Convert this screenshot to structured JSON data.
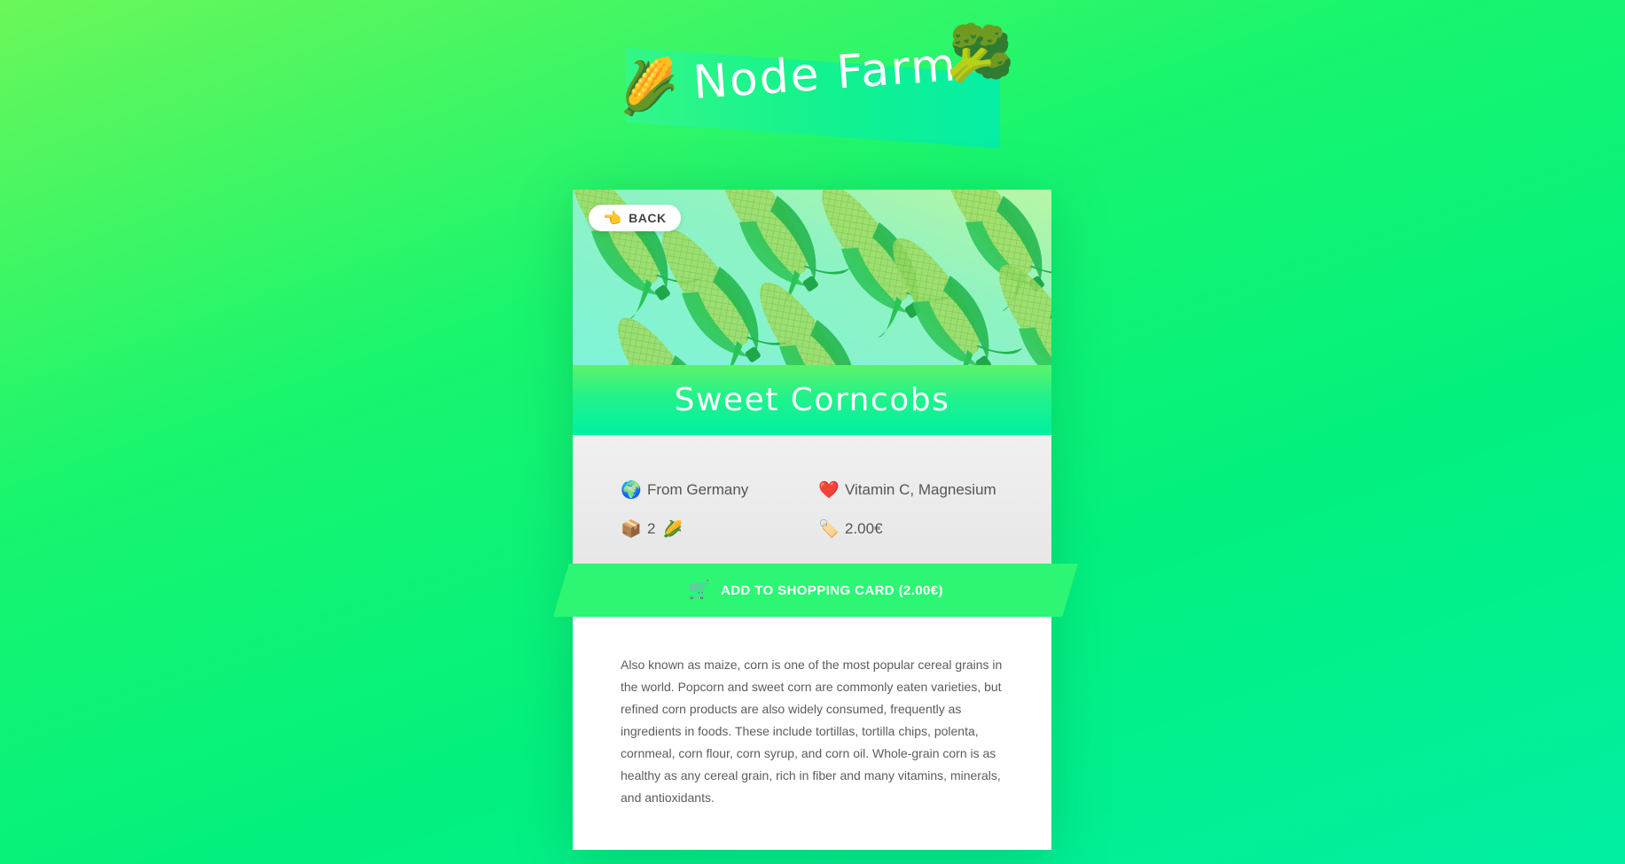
{
  "header": {
    "title": "Node Farm",
    "corn_icon": "🌽",
    "broccoli_icon": "🥦"
  },
  "product": {
    "back_icon": "👈",
    "back_label": "BACK",
    "name": "Sweet Corncobs",
    "origin_icon": "🌍",
    "origin": "From Germany",
    "nutrients_icon": "❤️",
    "nutrients": "Vitamin C, Magnesium",
    "quantity_icon": "📦",
    "quantity": "2",
    "quantity_emoji": "🌽",
    "price_icon": "🏷️",
    "price": "2.00€",
    "cart_icon": "🛒",
    "cart_label": "ADD TO SHOPPING CARD (2.00€)",
    "description": "Also known as maize, corn is one of the most popular cereal grains in the world. Popcorn and sweet corn are commonly eaten varieties, but refined corn products are also widely consumed, frequently as ingredients in foods. These include tortillas, tortilla chips, polenta, cornmeal, corn flour, corn syrup, and corn oil. Whole-grain corn is as healthy as any cereal grain, rich in fiber and many vitamins, minerals, and antioxidants."
  },
  "colors": {
    "background_start": "#6bf75a",
    "background_end": "#01efa3",
    "accent_green": "#2cf673",
    "band_top": "#5cf269",
    "band_bottom": "#00f0a2",
    "text_gray": "#555555",
    "hero_bg": "#8ff3c2"
  }
}
